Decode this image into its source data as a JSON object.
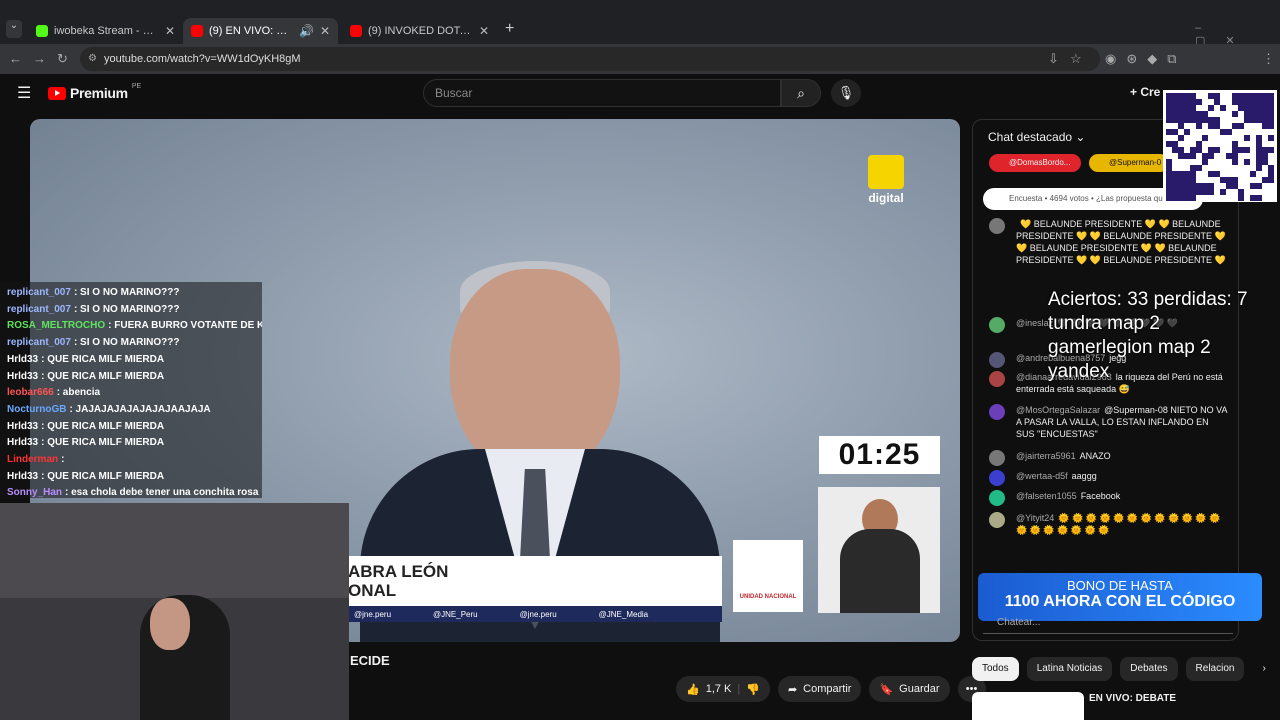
{
  "browser": {
    "tabs": [
      {
        "title": "iwobeka Stream - Watch Live o",
        "active": false,
        "color": "#53fc18"
      },
      {
        "title": "(9) EN VIVO: DEBATE PRESI",
        "active": true,
        "color": "#ff0000"
      },
      {
        "title": "(9) INVOKED DOTA - YouTube",
        "active": false,
        "color": "#ff0000"
      }
    ],
    "new_tab": "+",
    "url": "youtube.com/watch?v=WW1dOyKH8gM"
  },
  "youtube": {
    "logo": "Premium",
    "region": "PE",
    "search_placeholder": "Buscar",
    "create_label": "Cre",
    "notif_count": "9+"
  },
  "video": {
    "brand": "digital",
    "timer": "01:25",
    "lower_third_lines": [
      "ABRA LEÓN",
      "ONAL"
    ],
    "socials": [
      "@jne.peru",
      "@JNE_Peru",
      "@jne.peru",
      "@JNE_Media"
    ],
    "logo_text": "UNIDAD NACIONAL",
    "title_fragment": "ECIDE"
  },
  "stream_chat": [
    {
      "user": "replicant_007",
      "text": ": SI O NO MARINO???",
      "color": "#9bb7ff"
    },
    {
      "user": "replicant_007",
      "text": ": SI O NO MARINO???",
      "color": "#9bb7ff"
    },
    {
      "user": "ROSA_MELTROCHO",
      "text": ": FUERA BURRO VOTANTE DE KEIKO",
      "color": "#5fe35f"
    },
    {
      "user": "replicant_007",
      "text": ": SI O NO MARINO???",
      "color": "#9bb7ff"
    },
    {
      "user": "Hrld33",
      "text": ": QUE RICA MILF MIERDA",
      "color": "#ffffff"
    },
    {
      "user": "Hrld33",
      "text": ": QUE RICA MILF MIERDA",
      "color": "#ffffff"
    },
    {
      "user": "leobar666",
      "text": ": abencia",
      "color": "#ff5555"
    },
    {
      "user": "NocturnoGB",
      "text": ": JAJAJAJAJAJAJAJAAJAJA",
      "color": "#6aa8ff"
    },
    {
      "user": "Hrld33",
      "text": ": QUE RICA MILF MIERDA",
      "color": "#ffffff"
    },
    {
      "user": "Hrld33",
      "text": ": QUE RICA MILF MIERDA",
      "color": "#ffffff"
    },
    {
      "user": "Linderman",
      "text": ":",
      "color": "#ff3333"
    },
    {
      "user": "Hrld33",
      "text": ": QUE RICA MILF MIERDA",
      "color": "#ffffff"
    },
    {
      "user": "Sonny_Han",
      "text": ": esa chola debe tener una conchita rosa",
      "color": "#b98cff"
    }
  ],
  "live_chat": {
    "header": "Chat destacado",
    "pinned": [
      "@DomasBordo...",
      "@Superman-0"
    ],
    "poll": "Encuesta • 4694 votos • ¿Las propuesta qu",
    "messages": [
      {
        "author": "",
        "text": "💛 BELAUNDE PRESIDENTE 💛 💛 BELAUNDE PRESIDENTE 💛 💛 BELAUNDE PRESIDENTE 💛 💛 BELAUNDE PRESIDENTE 💛 💛 BELAUNDE PRESIDENTE 💛 💛 BELAUNDE PRESIDENTE 💛"
      },
      {
        "author": "@ineslaz",
        "text": "🖤 🖤 🖤 🖤 🖤 🖤 🖤 🖤 🖤"
      },
      {
        "author": "@andrebalbuena8757",
        "text": "jegg"
      },
      {
        "author": "@dianaarredavidal2983",
        "text": "la riqueza del Perú no está enterrada está saqueada 😅"
      },
      {
        "author": "@MosOrtegaSalazar",
        "text": "@Superman-08 NIETO NO VA A PASAR LA VALLA, LO ESTAN INFLANDO EN SUS \"ENCUESTAS\""
      },
      {
        "author": "@jairterra5961",
        "text": "ANAZO"
      },
      {
        "author": "@wertaa-d5f",
        "text": "aaggg"
      },
      {
        "author": "@falseten1055",
        "text": "Facebook"
      },
      {
        "author": "@Yityit24",
        "text": "🌞 🌞 🌞 🌞 🌞 🌞 🌞 🌞 🌞 🌞 🌞 🌞 🌞 🌞 🌞 🌞 🌞 🌞 🌞"
      }
    ],
    "input_placeholder": "Chatear..."
  },
  "overlay": {
    "stats": "Aciertos: 33 perdidas: 7\ntundra map 2\ngamerlegion map 2\nyandex",
    "bono_line1": "BONO DE HASTA",
    "bono_line2": "1100 AHORA CON EL CÓDIGO"
  },
  "actions": {
    "likes": "1,7 K",
    "share": "Compartir",
    "save": "Guardar"
  },
  "chips": [
    "Todos",
    "Latina Noticias",
    "Debates",
    "Relacion"
  ],
  "related_title": "EN VIVO: DEBATE"
}
